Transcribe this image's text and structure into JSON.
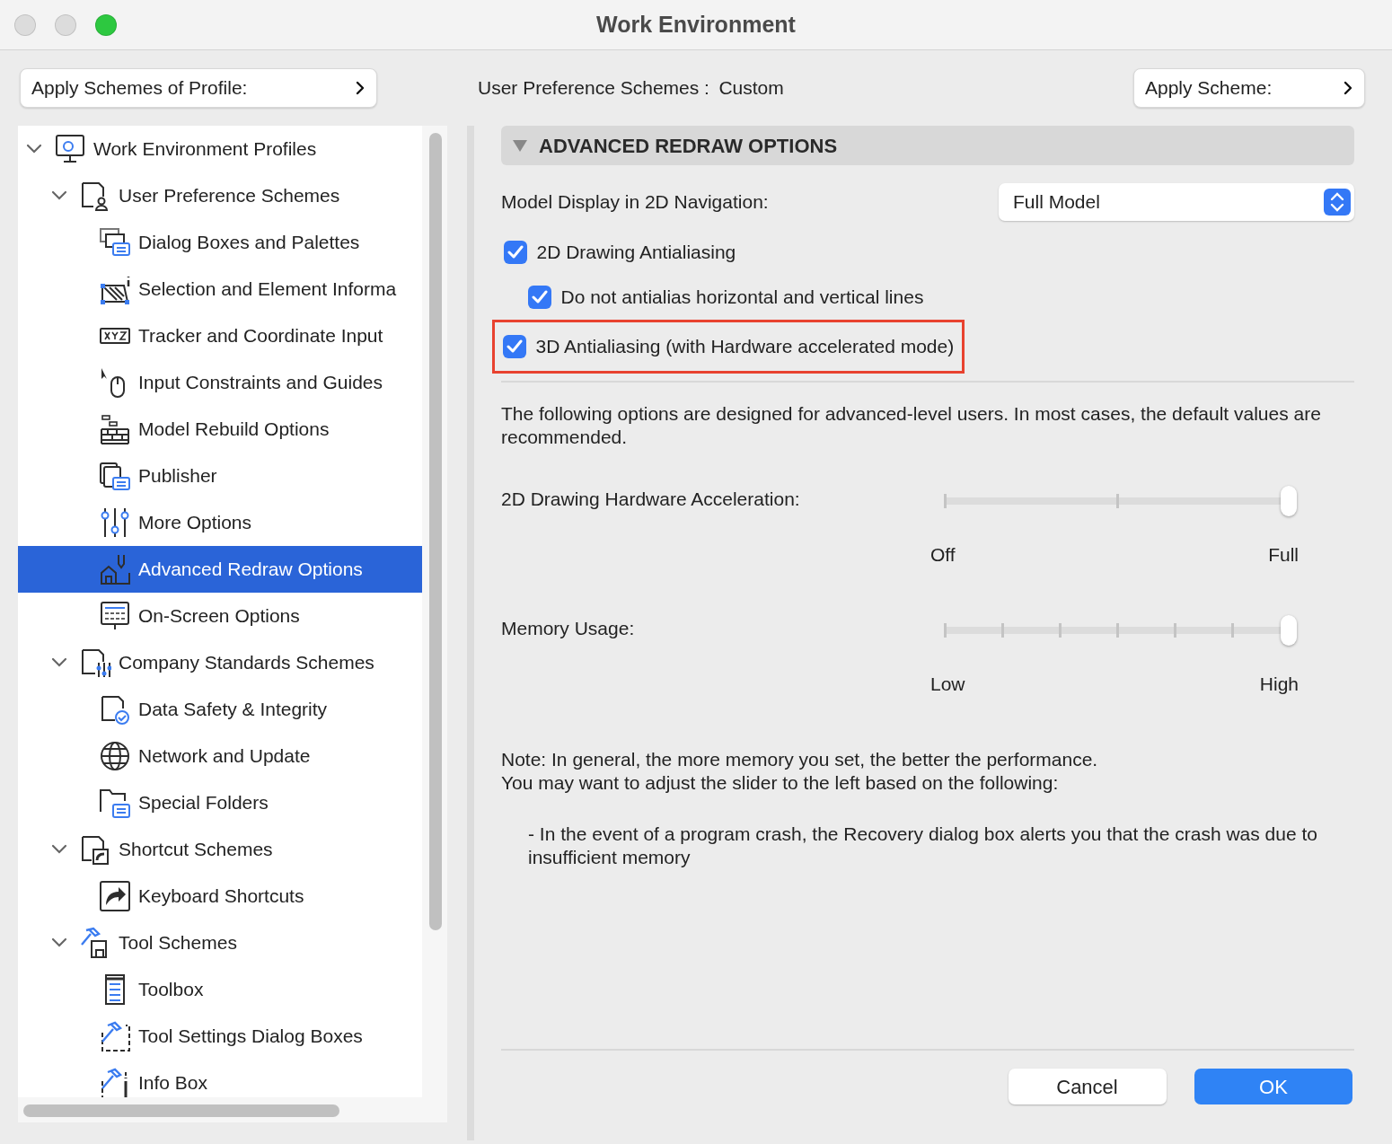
{
  "window": {
    "title": "Work Environment"
  },
  "toolbar": {
    "profile_button": "Apply Schemes of Profile:",
    "scheme_label": "User Preference Schemes :",
    "scheme_value": "Custom",
    "scheme_button": "Apply Scheme:"
  },
  "tree": [
    {
      "label": "Work Environment Profiles",
      "selected": false,
      "expanded": true,
      "children": [
        {
          "label": "User Preference Schemes",
          "selected": false,
          "expanded": true,
          "children": [
            {
              "label": "Dialog Boxes and Palettes",
              "selected": false
            },
            {
              "label": "Selection and Element Informa",
              "selected": false
            },
            {
              "label": "Tracker and Coordinate Input",
              "selected": false
            },
            {
              "label": "Input Constraints and Guides",
              "selected": false
            },
            {
              "label": "Model Rebuild Options",
              "selected": false
            },
            {
              "label": "Publisher",
              "selected": false
            },
            {
              "label": "More Options",
              "selected": false
            },
            {
              "label": "Advanced Redraw Options",
              "selected": true
            },
            {
              "label": "On-Screen Options",
              "selected": false
            }
          ]
        },
        {
          "label": "Company Standards Schemes",
          "selected": false,
          "expanded": true,
          "children": [
            {
              "label": "Data Safety & Integrity",
              "selected": false
            },
            {
              "label": "Network and Update",
              "selected": false
            },
            {
              "label": "Special Folders",
              "selected": false
            }
          ]
        },
        {
          "label": "Shortcut Schemes",
          "selected": false,
          "expanded": true,
          "children": [
            {
              "label": "Keyboard Shortcuts",
              "selected": false
            }
          ]
        },
        {
          "label": "Tool Schemes",
          "selected": false,
          "expanded": true,
          "children": [
            {
              "label": "Toolbox",
              "selected": false
            },
            {
              "label": "Tool Settings Dialog Boxes",
              "selected": false
            },
            {
              "label": "Info Box",
              "selected": false
            }
          ]
        }
      ]
    }
  ],
  "panel": {
    "title": "ADVANCED REDRAW OPTIONS",
    "expanded": true,
    "model_display": {
      "label": "Model Display in 2D Navigation:",
      "value": "Full Model"
    },
    "checkboxes": [
      {
        "label": "2D Drawing Antialiasing",
        "checked": true,
        "highlighted": false,
        "children": [
          {
            "label": "Do not antialias horizontal and vertical lines",
            "checked": true,
            "highlighted": false
          }
        ]
      },
      {
        "label": "3D Antialiasing (with Hardware accelerated mode)",
        "checked": true,
        "highlighted": true
      }
    ],
    "intro": "The following options are designed for advanced-level users. In most cases, the default values are recommended.",
    "sliders": [
      {
        "label": "2D Drawing Hardware Acceleration:",
        "level": 1,
        "min_label": "Off",
        "max_label": "Full"
      },
      {
        "label": "Memory Usage:",
        "level": 1,
        "min_label": "Low",
        "max_label": "High"
      }
    ],
    "note": [
      "Note: In general, the more memory you set, the better the performance.",
      "You may want to adjust the slider to the left based on the following:"
    ],
    "bullet": "- In the event of a program crash, the Recovery dialog box alerts you that the crash was due to insufficient memory"
  },
  "buttons": [
    {
      "label": "Cancel",
      "kind": "secondary"
    },
    {
      "label": "OK",
      "kind": "primary"
    }
  ]
}
